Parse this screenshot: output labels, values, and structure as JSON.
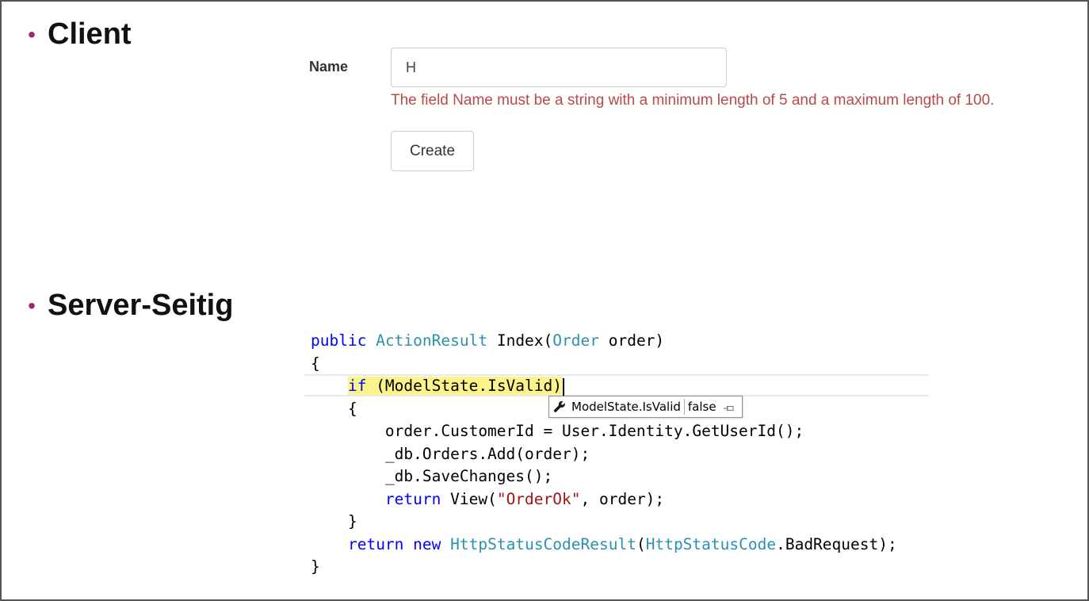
{
  "bullets": {
    "client": "Client",
    "server": "Server-Seitig"
  },
  "form": {
    "name_label": "Name",
    "name_value": "H",
    "validation_message": "The field Name must be a string with a minimum length of 5 and a maximum length of 100.",
    "create_button": "Create"
  },
  "code": {
    "l1": {
      "kw": "public",
      "t1": "ActionResult",
      "p1": " Index(",
      "t2": "Order",
      "p2": " order)"
    },
    "l2": "{",
    "l3": {
      "indent": "    ",
      "kw": "if",
      "rest": " (ModelState.IsValid)"
    },
    "l4": "    {",
    "l5": "        order.CustomerId = User.Identity.GetUserId();",
    "l6": "        _db.Orders.Add(order);",
    "l7": "        _db.SaveChanges();",
    "l8": {
      "indent": "        ",
      "kw": "return",
      "p1": " View(",
      "str": "\"OrderOk\"",
      "p2": ", order);"
    },
    "l9": "    }",
    "l10": {
      "indent": "    ",
      "kw1": "return",
      "sp": " ",
      "kw2": "new",
      "p0": " ",
      "t1": "HttpStatusCodeResult",
      "p1": "(",
      "t2": "HttpStatusCode",
      "p2": ".BadRequest);"
    },
    "l11": "}"
  },
  "datatip": {
    "icon": "wrench-icon",
    "expression": "ModelState.IsValid",
    "value": "false",
    "pin_icon": "pin-icon"
  },
  "colors": {
    "bullet": "#9c2a6e",
    "validation": "#b94a48",
    "keyword": "#0000ff",
    "type": "#2b91af",
    "string": "#a31515",
    "highlight": "#fbf48a"
  }
}
